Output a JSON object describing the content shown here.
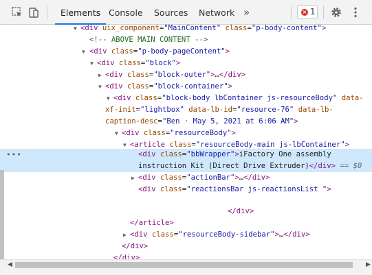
{
  "toolbar": {
    "tabs": [
      "Elements",
      "Console",
      "Sources",
      "Network"
    ],
    "more_tabs": "»",
    "error_count": "1",
    "icons": [
      "inspect-element-icon",
      "device-toolbar-icon",
      "gear-icon",
      "kebab-menu-icon"
    ]
  },
  "tree": {
    "l0": {
      "open": "<",
      "tag": "div",
      "a1": "uix_component",
      "v1": "\"MainContent\"",
      "a2": "class",
      "v2": "\"p-body-content\"",
      "close": ">"
    },
    "l1": {
      "comment": "<!-- ABOVE MAIN CONTENT -->"
    },
    "l2": {
      "tag": "div",
      "a1": "class",
      "v1": "\"p-body-pageContent\""
    },
    "l3": {
      "tag": "div",
      "a1": "class",
      "v1": "\"block\""
    },
    "l4": {
      "tag": "div",
      "a1": "class",
      "v1": "\"block-outer\"",
      "collapsed": "…",
      "end": "</div>"
    },
    "l5": {
      "tag": "div",
      "a1": "class",
      "v1": "\"block-container\""
    },
    "l6a": {
      "tag": "div",
      "a1": "class",
      "v1": "\"block-body lbContainer js-resourceBody\"",
      "a2": "data-"
    },
    "l6b": {
      "a2b": "xf-init",
      "v2": "\"lightbox\"",
      "a3": "data-lb-id",
      "v3": "\"resource-76\"",
      "a4": "data-lb-"
    },
    "l6c": {
      "a4b": "caption-desc",
      "v4": "\"Ben · May 5, 2021 at 6:06 AM\""
    },
    "l7": {
      "tag": "div",
      "a1": "class",
      "v1": "\"resourceBody\""
    },
    "l8": {
      "tag": "article",
      "a1": "class",
      "v1": "\"resourceBody-main js-lbContainer\""
    },
    "l9a": {
      "dots": "•••",
      "tag": "div",
      "a1": "class",
      "v1": "\"bbWrapper\"",
      "text": "iFactory One assembly"
    },
    "l9b": {
      "text": "instruction Kit (Direct Drive Extruder)",
      "end": "</div>",
      "marker": "== $0"
    },
    "l10": {
      "tag": "div",
      "a1": "class",
      "v1": "\"actionBar\"",
      "collapsed": "…",
      "end": "</div>"
    },
    "l11": {
      "tag": "div",
      "a1": "class",
      "v1": "\"reactionsBar js-reactionsList \""
    },
    "l12": {
      "end": "</div>"
    },
    "l13": {
      "end": "</article>"
    },
    "l14": {
      "tag": "div",
      "a1": "class",
      "v1": "\"resourceBody-sidebar\"",
      "collapsed": "…",
      "end": "</div>"
    },
    "l15": {
      "end": "</div>"
    },
    "l16": {
      "end": "</div>"
    }
  },
  "colors": {
    "tag": "#881280",
    "attr": "#994500",
    "value": "#1a1aa6",
    "comment": "#236e25",
    "selection": "#cfe8fc",
    "active_tab": "#1a73e8",
    "error": "#d93025"
  }
}
